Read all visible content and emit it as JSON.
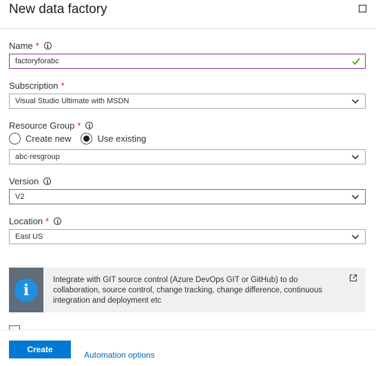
{
  "blade": {
    "title": "New data factory"
  },
  "name_field": {
    "label": "Name",
    "required": "*",
    "value": "factoryforabc"
  },
  "subscription": {
    "label": "Subscription",
    "required": "*",
    "selected": "Visual Studio Ultimate with MSDN"
  },
  "resource_group": {
    "label": "Resource Group",
    "required": "*",
    "options": [
      {
        "label": "Create new",
        "checked": false
      },
      {
        "label": "Use existing",
        "checked": true
      }
    ],
    "selected": "abc-resgroup"
  },
  "version": {
    "label": "Version",
    "selected": "V2"
  },
  "location": {
    "label": "Location",
    "required": "*",
    "selected": "East US"
  },
  "git_banner": {
    "icon": "info-icon",
    "text": "Integrate with GIT source control (Azure DevOps GIT or GitHub) to do collaboration, source control, change tracking, change difference, continuous integration and deployment etc"
  },
  "footer": {
    "create_label": "Create",
    "automation_label": "Automation options"
  },
  "colors": {
    "accent": "#0078d4",
    "required": "#e00b1c",
    "success": "#57a300",
    "focus": "#8c2f90",
    "banner_icon": "#1e90e0"
  }
}
